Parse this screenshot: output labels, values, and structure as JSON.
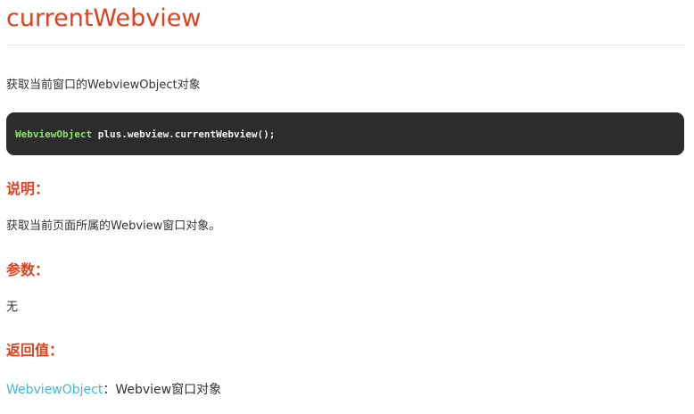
{
  "title": "currentWebview",
  "summary": "获取当前窗口的WebviewObject对象",
  "code": {
    "type": "WebviewObject",
    "rest": " plus.webview.currentWebview();"
  },
  "sections": {
    "description": {
      "heading": "说明：",
      "text": "获取当前页面所属的Webview窗口对象。"
    },
    "params": {
      "heading": "参数：",
      "text": "无"
    },
    "returns": {
      "heading": "返回值：",
      "link": "WebviewObject",
      "text": "：Webview窗口对象"
    }
  },
  "colors": {
    "accent": "#e2401c",
    "link": "#3fb7d9",
    "code_bg": "#2c2c2c",
    "code_type": "#8fe36f"
  }
}
